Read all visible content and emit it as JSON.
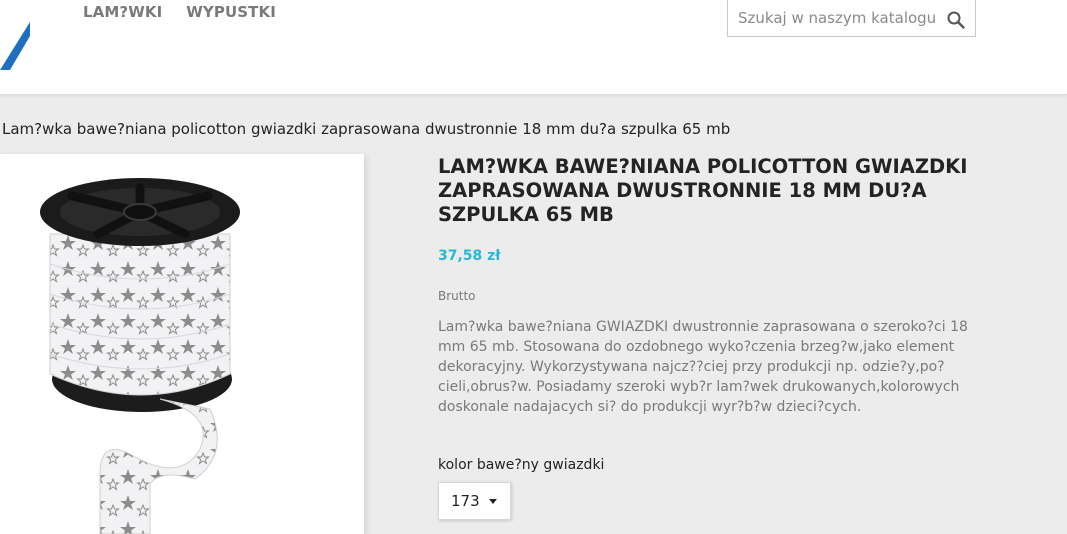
{
  "header": {
    "nav": [
      {
        "label": "LAM?WKI"
      },
      {
        "label": "WYPUSTKI"
      }
    ],
    "search": {
      "placeholder": "Szukaj w naszym katalogu",
      "value": ""
    }
  },
  "breadcrumb": {
    "current": "Lam?wka bawe?niana policotton gwiazdki zaprasowana dwustronnie 18 mm du?a szpulka 65 mb"
  },
  "product": {
    "title": "LAM?WKA BAWE?NIANA POLICOTTON GWIAZDKI ZAPRASOWANA DWUSTRONNIE 18 MM DU?A SZPULKA 65 MB",
    "price": "37,58 zł",
    "tax_label": "Brutto",
    "description": "Lam?wka bawe?niana GWIAZDKI dwustronnie zaprasowana o szeroko?ci 18 mm 65 mb. Stosowana do ozdobnego wyko?czenia brzeg?w,jako element dekoracyjny. Wykorzystywana najcz??ciej przy produkcji np. odzie?y,po?cieli,obrus?w. Posiadamy szeroki wyb?r lam?wek drukowanych,kolorowych doskonale nadajacych si? do produkcji wyr?b?w dzieci?cych.",
    "variant": {
      "label": "kolor bawe?ny gwiazdki",
      "selected": "173"
    }
  },
  "colors": {
    "accent": "#24b9d7",
    "logo": "#1f6fbf"
  }
}
